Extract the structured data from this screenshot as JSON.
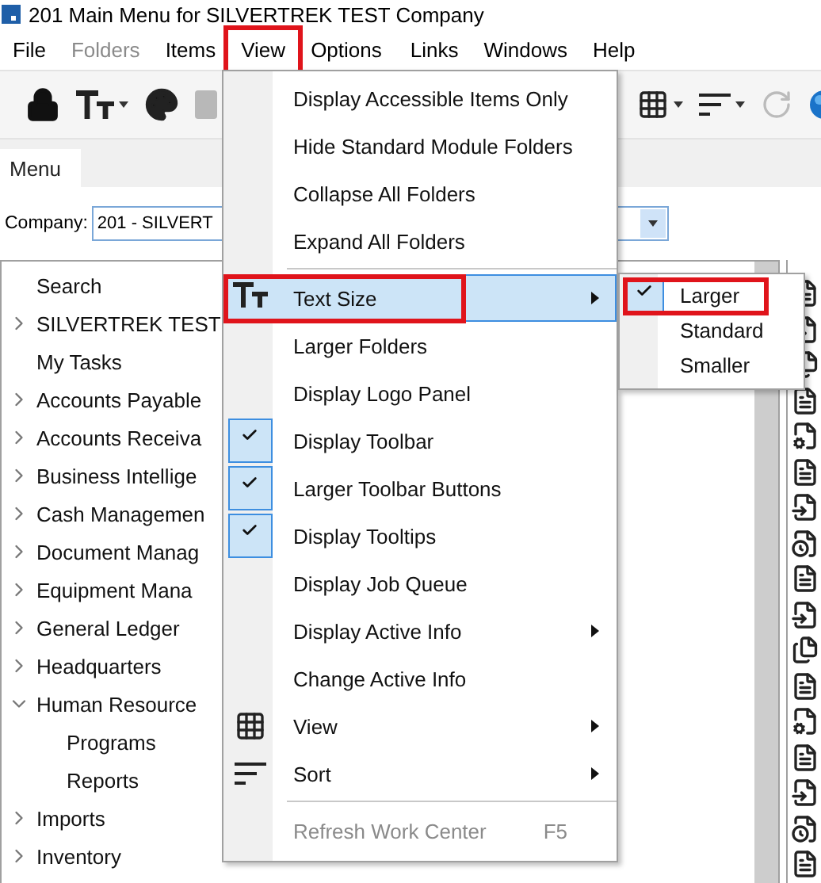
{
  "window": {
    "title": "201 Main Menu for SILVERTREK TEST Company"
  },
  "menubar": [
    {
      "label": "File",
      "disabled": false,
      "annotated": false
    },
    {
      "label": "Folders",
      "disabled": true,
      "annotated": false
    },
    {
      "label": "Items",
      "disabled": false,
      "annotated": false
    },
    {
      "label": "View",
      "disabled": false,
      "annotated": true
    },
    {
      "label": "Options",
      "disabled": false,
      "annotated": false
    },
    {
      "label": "Links",
      "disabled": false,
      "annotated": false
    },
    {
      "label": "Windows",
      "disabled": false,
      "annotated": false
    },
    {
      "label": "Help",
      "disabled": false,
      "annotated": false
    }
  ],
  "tabs": [
    {
      "label": "Menu",
      "selected": true
    }
  ],
  "company": {
    "label": "Company:",
    "value": "201 - SILVERT"
  },
  "tree": [
    {
      "label": "Search",
      "kind": "leaf"
    },
    {
      "label": "SILVERTREK TEST",
      "kind": "folder",
      "expanded": false
    },
    {
      "label": "My Tasks",
      "kind": "leaf"
    },
    {
      "label": "Accounts Payable",
      "kind": "folder",
      "expanded": false
    },
    {
      "label": "Accounts Receiva",
      "kind": "folder",
      "expanded": false
    },
    {
      "label": "Business Intellige",
      "kind": "folder",
      "expanded": false
    },
    {
      "label": "Cash Managemen",
      "kind": "folder",
      "expanded": false
    },
    {
      "label": "Document Manag",
      "kind": "folder",
      "expanded": false
    },
    {
      "label": "Equipment Mana",
      "kind": "folder",
      "expanded": false
    },
    {
      "label": "General Ledger",
      "kind": "folder",
      "expanded": false
    },
    {
      "label": "Headquarters",
      "kind": "folder",
      "expanded": false
    },
    {
      "label": "Human Resource",
      "kind": "folder",
      "expanded": true,
      "children": [
        {
          "label": "Programs",
          "kind": "leaf"
        },
        {
          "label": "Reports",
          "kind": "leaf"
        }
      ]
    },
    {
      "label": "Imports",
      "kind": "folder",
      "expanded": false
    },
    {
      "label": "Inventory",
      "kind": "folder",
      "expanded": false
    }
  ],
  "view_menu": [
    {
      "kind": "command",
      "label": "Display Accessible Items Only",
      "checked": false,
      "selected": false,
      "disabled": false,
      "submenu": false,
      "annotated": false
    },
    {
      "kind": "command",
      "label": "Hide Standard Module Folders",
      "checked": false,
      "selected": false,
      "disabled": false,
      "submenu": false,
      "annotated": false
    },
    {
      "kind": "command",
      "label": "Collapse All Folders",
      "checked": false,
      "selected": false,
      "disabled": false,
      "submenu": false,
      "annotated": false
    },
    {
      "kind": "command",
      "label": "Expand All Folders",
      "checked": false,
      "selected": false,
      "disabled": false,
      "submenu": false,
      "annotated": false
    },
    {
      "kind": "separator"
    },
    {
      "kind": "text-size",
      "label": "Text Size",
      "checked": false,
      "selected": true,
      "disabled": false,
      "submenu": true,
      "annotated": true
    },
    {
      "kind": "command",
      "label": "Larger Folders",
      "checked": false,
      "selected": false,
      "disabled": false,
      "submenu": false,
      "annotated": false
    },
    {
      "kind": "command",
      "label": "Display Logo Panel",
      "checked": false,
      "selected": false,
      "disabled": false,
      "submenu": false,
      "annotated": false
    },
    {
      "kind": "command",
      "label": "Display Toolbar",
      "checked": true,
      "selected": false,
      "disabled": false,
      "submenu": false,
      "annotated": false
    },
    {
      "kind": "command",
      "label": "Larger Toolbar Buttons",
      "checked": true,
      "selected": false,
      "disabled": false,
      "submenu": false,
      "annotated": false
    },
    {
      "kind": "command",
      "label": "Display Tooltips",
      "checked": true,
      "selected": false,
      "disabled": false,
      "submenu": false,
      "annotated": false
    },
    {
      "kind": "command",
      "label": "Display Job Queue",
      "checked": false,
      "selected": false,
      "disabled": false,
      "submenu": false,
      "annotated": false
    },
    {
      "kind": "command",
      "label": "Display Active Info",
      "checked": false,
      "selected": false,
      "disabled": false,
      "submenu": true,
      "annotated": false
    },
    {
      "kind": "command",
      "label": "Change Active Info",
      "checked": false,
      "selected": false,
      "disabled": false,
      "submenu": false,
      "annotated": false
    },
    {
      "kind": "view",
      "label": "View",
      "checked": false,
      "selected": false,
      "disabled": false,
      "submenu": true,
      "annotated": false
    },
    {
      "kind": "sort",
      "label": "Sort",
      "checked": false,
      "selected": false,
      "disabled": false,
      "submenu": true,
      "annotated": false
    },
    {
      "kind": "separator"
    },
    {
      "kind": "command",
      "label": "Refresh Work Center",
      "shortcut": "F5",
      "checked": false,
      "selected": false,
      "disabled": true,
      "submenu": false,
      "annotated": false
    }
  ],
  "text_size_menu": [
    {
      "label": "Larger",
      "checked": true,
      "annotated": true
    },
    {
      "label": "Standard",
      "checked": false,
      "annotated": false
    },
    {
      "label": "Smaller",
      "checked": false,
      "annotated": false
    }
  ]
}
